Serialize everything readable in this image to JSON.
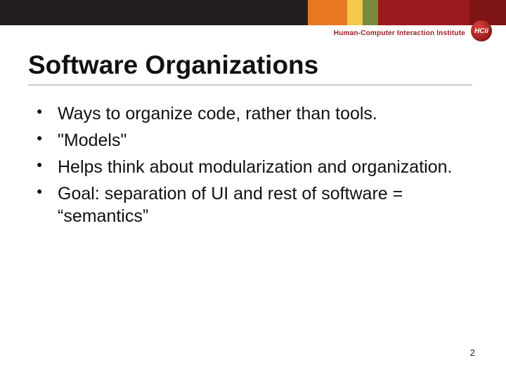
{
  "header": {
    "institute_label": "Human-Computer Interaction Institute",
    "logo_initials": "HCii"
  },
  "slide": {
    "title": "Software Organizations",
    "bullets": [
      "Ways to organize code, rather than tools.",
      "\"Models\"",
      "Helps think about modularization and organization.",
      "Goal: separation of UI and rest of software = “semantics”"
    ],
    "page_number": "2"
  }
}
